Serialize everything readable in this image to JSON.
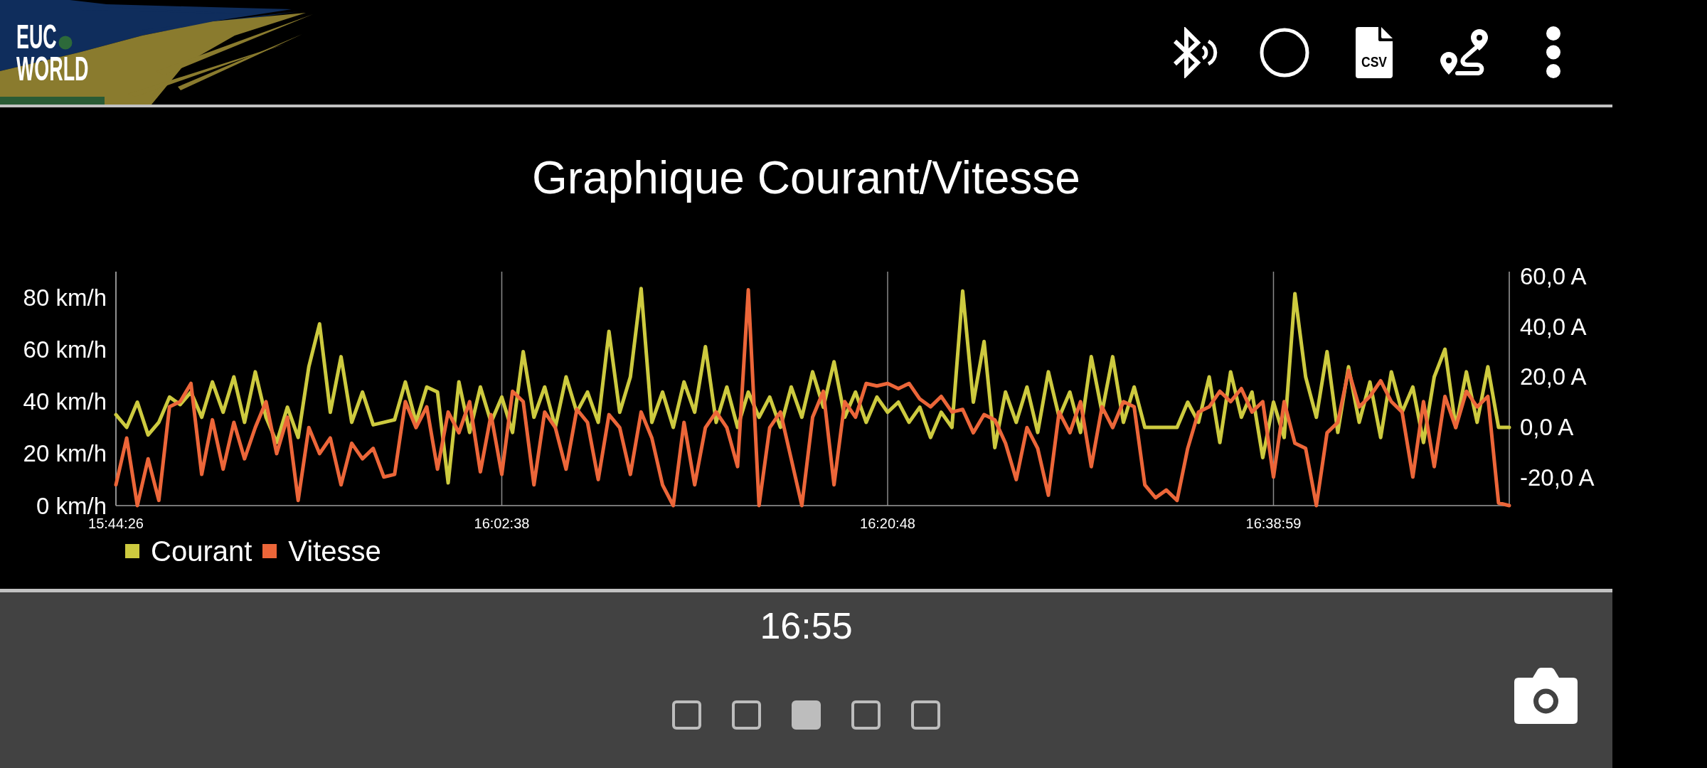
{
  "header": {
    "logo": {
      "lines": [
        "EUC",
        "WORLD"
      ]
    },
    "csv_label": "CSV"
  },
  "chart": {
    "chart_data": {
      "type": "line",
      "title": "Graphique Courant/Vitesse",
      "legend": "bottom-left",
      "ylim": [
        0,
        90
      ],
      "y2lim": [
        -31,
        61.7
      ],
      "categories": [
        "15:44:26",
        null,
        null,
        null,
        null,
        null,
        null,
        null,
        null,
        null,
        null,
        null,
        null,
        null,
        null,
        null,
        null,
        null,
        null,
        null,
        null,
        null,
        null,
        null,
        null,
        null,
        null,
        null,
        null,
        null,
        null,
        null,
        null,
        null,
        null,
        null,
        "16:02:38",
        null,
        null,
        null,
        null,
        null,
        null,
        null,
        null,
        null,
        null,
        null,
        null,
        null,
        null,
        null,
        null,
        null,
        null,
        null,
        null,
        null,
        null,
        null,
        null,
        null,
        null,
        null,
        null,
        null,
        null,
        null,
        null,
        null,
        null,
        null,
        "16:20:48",
        null,
        null,
        null,
        null,
        null,
        null,
        null,
        null,
        null,
        null,
        null,
        null,
        null,
        null,
        null,
        null,
        null,
        null,
        null,
        null,
        null,
        null,
        null,
        null,
        null,
        null,
        null,
        null,
        null,
        null,
        null,
        null,
        null,
        null,
        null,
        "16:38:59",
        null,
        null,
        null,
        null,
        null,
        null,
        null,
        null,
        null,
        null,
        null,
        null,
        null,
        null,
        null,
        null,
        null,
        null,
        null,
        null,
        null,
        null
      ],
      "yticks": [
        {
          "value": 0,
          "label": "0 km/h"
        },
        {
          "value": 20,
          "label": "20 km/h"
        },
        {
          "value": 40,
          "label": "40 km/h"
        },
        {
          "value": 60,
          "label": "60 km/h"
        },
        {
          "value": 80,
          "label": "80 km/h"
        }
      ],
      "y2ticks": [
        {
          "value": -20,
          "label": "-20,0 A"
        },
        {
          "value": 0,
          "label": "0,0 A"
        },
        {
          "value": 20,
          "label": "20,0 A"
        },
        {
          "value": 40,
          "label": "40,0 A"
        },
        {
          "value": 60,
          "label": "60,0 A"
        }
      ],
      "series": [
        {
          "name": "Courant",
          "color": "#cdca3f",
          "axis": "y2",
          "values": [
            5,
            0,
            10,
            -3,
            2,
            12,
            9,
            14,
            4,
            18,
            6,
            20,
            2,
            22,
            4,
            -6,
            8,
            -4,
            24,
            41,
            6,
            28,
            2,
            14,
            1,
            2,
            3,
            18,
            2,
            16,
            14,
            -22,
            18,
            -2,
            16,
            2,
            12,
            -2,
            30,
            4,
            16,
            0,
            20,
            6,
            14,
            2,
            38,
            6,
            20,
            55,
            2,
            14,
            0,
            18,
            6,
            32,
            2,
            16,
            0,
            14,
            4,
            12,
            0,
            16,
            4,
            22,
            8,
            26,
            4,
            14,
            2,
            12,
            6,
            10,
            2,
            8,
            -4,
            6,
            0,
            54,
            10,
            34,
            -8,
            14,
            2,
            16,
            -2,
            22,
            4,
            14,
            -2,
            28,
            6,
            28,
            2,
            16,
            0,
            0,
            0,
            0,
            10,
            2,
            20,
            -6,
            22,
            4,
            14,
            -12,
            10,
            -4,
            53,
            20,
            4,
            30,
            -2,
            24,
            2,
            18,
            -4,
            22,
            6,
            16,
            -6,
            20,
            31,
            0,
            22,
            2,
            24,
            0,
            0
          ]
        },
        {
          "name": "Vitesse",
          "color": "#ec6639",
          "axis": "y",
          "values": [
            8,
            26,
            0,
            18,
            2,
            38,
            40,
            47,
            12,
            33,
            14,
            32,
            18,
            30,
            40,
            20,
            34,
            2,
            30,
            20,
            26,
            8,
            24,
            18,
            22,
            11,
            12,
            40,
            30,
            38,
            14,
            36,
            28,
            40,
            13,
            35,
            12,
            44,
            40,
            8,
            36,
            30,
            14,
            37,
            32,
            10,
            35,
            30,
            12,
            36,
            26,
            8,
            0,
            32,
            8,
            30,
            36,
            30,
            15,
            83,
            0,
            30,
            36,
            18,
            0,
            34,
            44,
            8,
            40,
            34,
            47,
            46,
            47,
            45,
            47,
            41,
            38,
            42,
            36,
            37,
            28,
            35,
            33,
            24,
            10,
            30,
            22,
            4,
            36,
            28,
            40,
            15,
            38,
            30,
            40,
            38,
            8,
            3,
            6,
            2,
            22,
            36,
            38,
            44,
            40,
            45,
            36,
            40,
            11,
            40,
            24,
            22,
            0,
            28,
            32,
            52,
            38,
            42,
            48,
            40,
            36,
            11,
            40,
            15,
            42,
            30,
            44,
            38,
            42,
            1,
            0
          ]
        }
      ]
    }
  },
  "footer": {
    "time": "16:55",
    "pages": [
      {
        "selected": false
      },
      {
        "selected": false
      },
      {
        "selected": true
      },
      {
        "selected": false
      },
      {
        "selected": false
      }
    ]
  }
}
